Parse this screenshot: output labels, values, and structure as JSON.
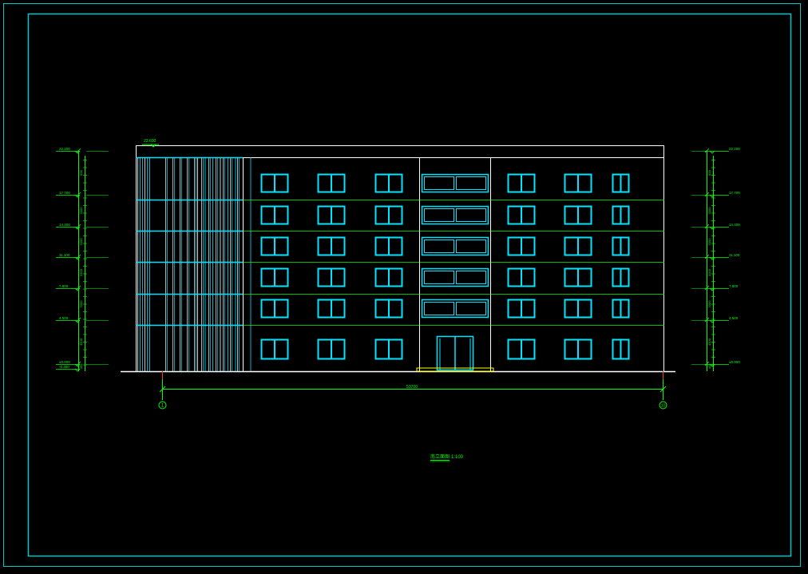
{
  "drawing": {
    "title": "南立面图",
    "scale": "1:100",
    "roof_level_label": "23.600",
    "overall_width": "53700",
    "axis_start": "1",
    "axis_end": "10"
  },
  "colors": {
    "background": "#000000",
    "frame": "#00c8c8",
    "windows": "#00e5ff",
    "outline": "#ffffff",
    "dimensions": "#00ff00",
    "grid_lines": "#00ff00",
    "entrance_steps": "#ffff00",
    "axis_ticks": "#ff3030"
  },
  "levels_left": [
    "22.200",
    "17.700",
    "14.400",
    "11.100",
    "7.800",
    "4.500",
    "±0.000",
    "-0.450"
  ],
  "levels_right": [
    "22.200",
    "17.700",
    "14.400",
    "11.100",
    "7.800",
    "4.500",
    "±0.000"
  ],
  "floor_heights_left": [
    "600",
    "3300",
    "3300",
    "3300",
    "3300",
    "4500",
    "450"
  ],
  "floor_heights_right": [
    "600",
    "3300",
    "3300",
    "3300",
    "3300",
    "4500",
    "450"
  ]
}
